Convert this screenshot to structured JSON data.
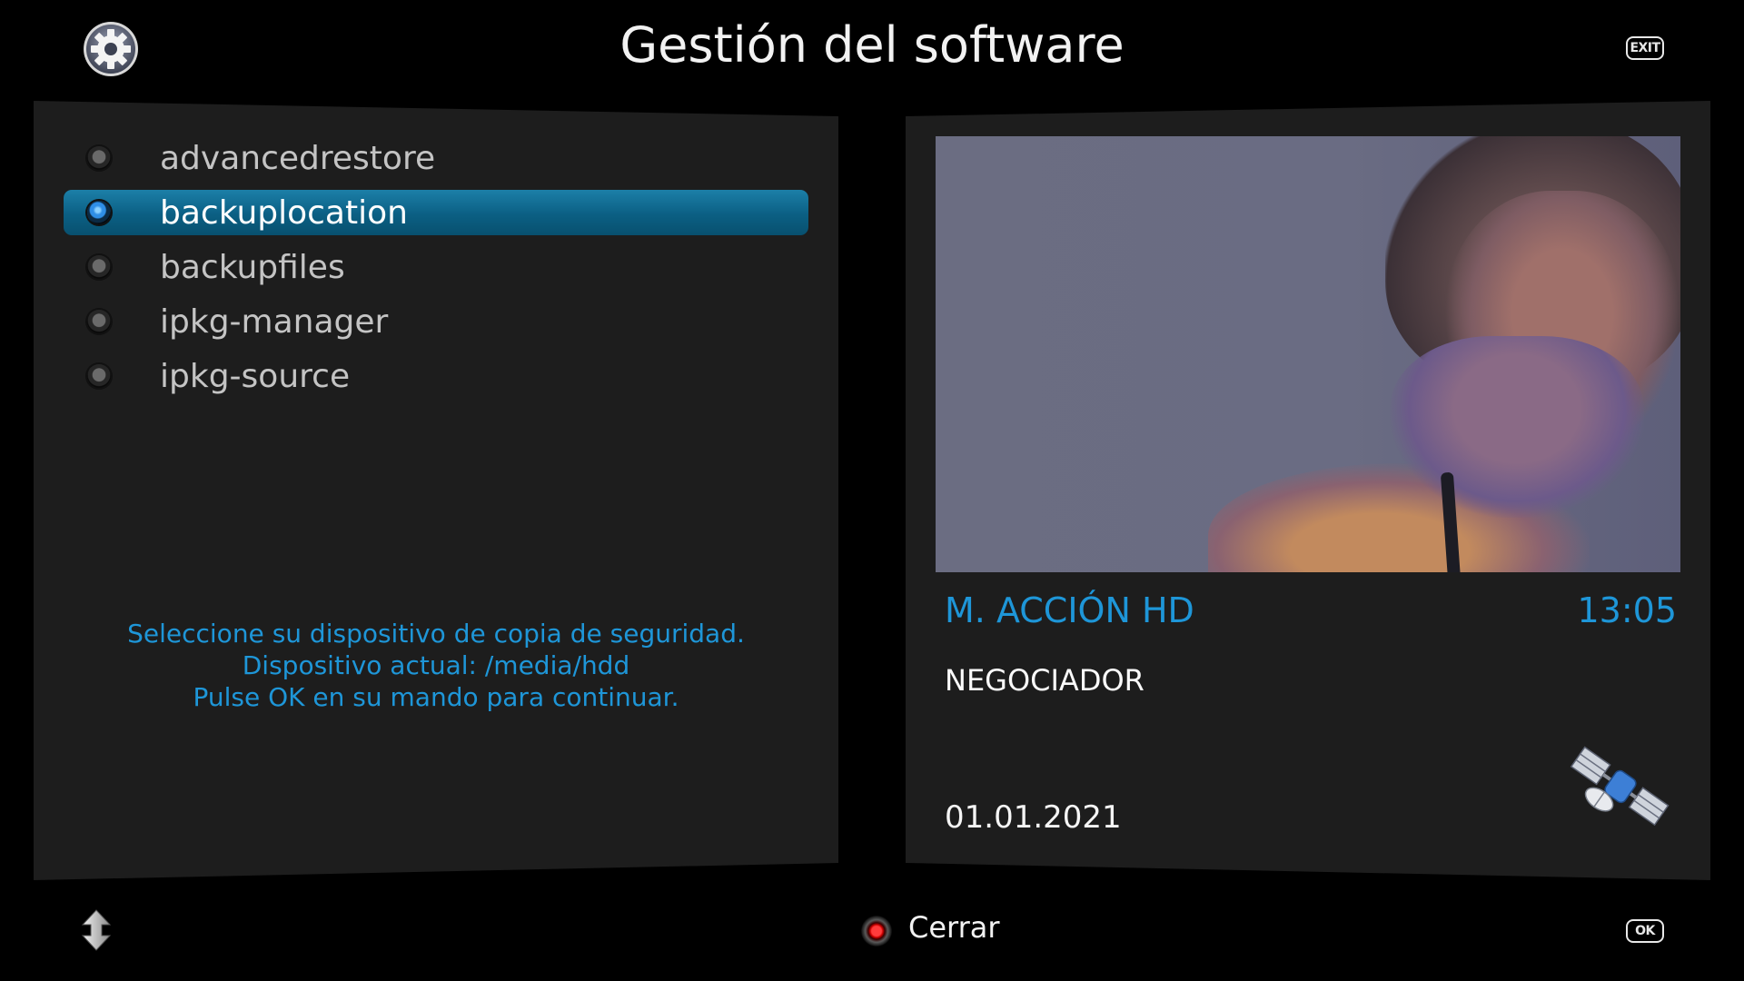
{
  "header": {
    "title": "Gestión del software",
    "exit_key": "EXIT"
  },
  "menu": {
    "selected_index": 1,
    "items": [
      {
        "label": "advancedrestore"
      },
      {
        "label": "backuplocation"
      },
      {
        "label": "backupfiles"
      },
      {
        "label": "ipkg-manager"
      },
      {
        "label": "ipkg-source"
      }
    ]
  },
  "info": {
    "lines": [
      "Seleccione su dispositivo de copia de seguridad.",
      "Dispositivo actual: /media/hdd",
      "Pulse OK en su mando para continuar."
    ]
  },
  "channel": {
    "name": "M. ACCIÓN HD",
    "time": "13:05",
    "event": "NEGOCIADOR",
    "date": "01.01.2021"
  },
  "footer": {
    "close_label": "Cerrar",
    "ok_key": "OK"
  },
  "colors": {
    "accent": "#1e96d8",
    "selection": "#0b5f83",
    "panel": "#1d1d1d",
    "background": "#000000"
  },
  "icons": {
    "header_left": "gear-icon",
    "header_right": "exit-key-icon",
    "footer_left": "up-down-arrows-icon",
    "footer_center": "red-button-icon",
    "footer_right": "ok-key-icon",
    "tuner": "satellite-icon"
  }
}
